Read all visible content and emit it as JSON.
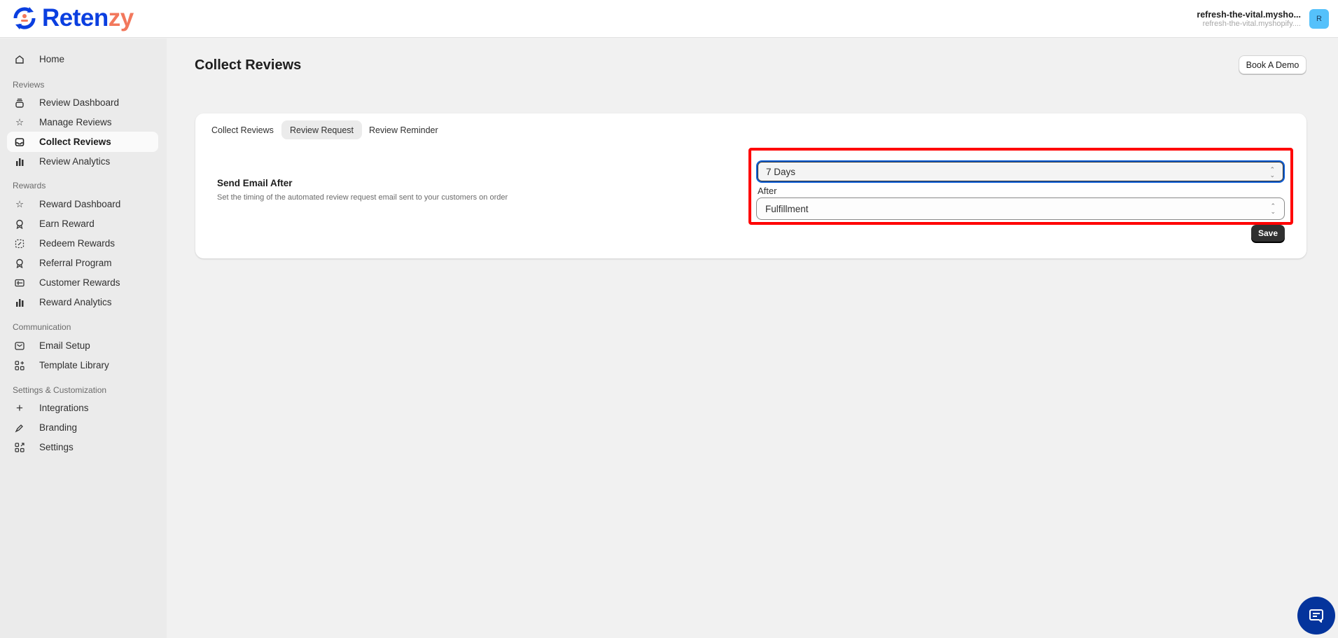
{
  "brand": {
    "name_primary": "Reten",
    "name_accent": "zy",
    "primary_color": "#0b3fe0",
    "accent_color": "#f2785c"
  },
  "store": {
    "name": "refresh-the-vital.mysho...",
    "domain": "refresh-the-vital.myshopify....",
    "avatar_initial": "R"
  },
  "sidebar": {
    "home": "Home",
    "sections": [
      {
        "label": "Reviews",
        "items": [
          "Review Dashboard",
          "Manage Reviews",
          "Collect Reviews",
          "Review Analytics"
        ]
      },
      {
        "label": "Rewards",
        "items": [
          "Reward Dashboard",
          "Earn Reward",
          "Redeem Rewards",
          "Referral Program",
          "Customer Rewards",
          "Reward Analytics"
        ]
      },
      {
        "label": "Communication",
        "items": [
          "Email Setup",
          "Template Library"
        ]
      },
      {
        "label": "Settings & Customization",
        "items": [
          "Integrations",
          "Branding",
          "Settings"
        ]
      }
    ],
    "active": "Collect Reviews"
  },
  "page": {
    "title": "Collect Reviews",
    "book_demo": "Book A Demo"
  },
  "tabs": [
    "Collect Reviews",
    "Review Request",
    "Review Reminder"
  ],
  "selected_tab": "Review Request",
  "setting": {
    "title": "Send Email After",
    "description": "Set the timing of the automated review request email sent to your customers on order",
    "delay_value": "7 Days",
    "after_label": "After",
    "event_value": "Fulfillment",
    "save_label": "Save"
  }
}
